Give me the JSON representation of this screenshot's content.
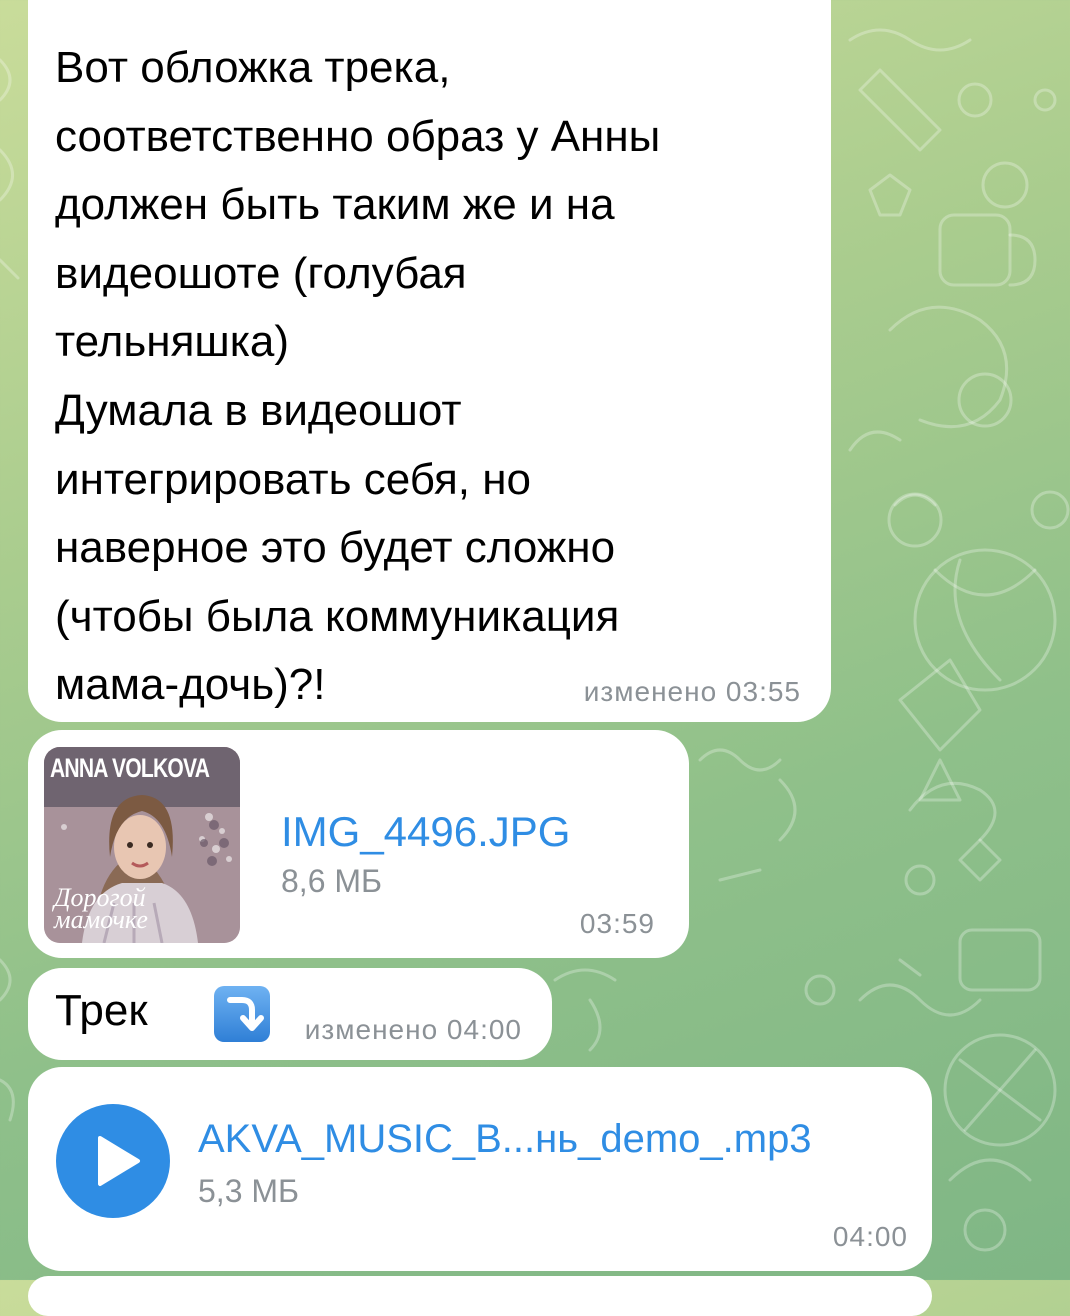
{
  "chat": {
    "messages": [
      {
        "type": "text",
        "text": "Вот обложка трека,\nсоответственно образ у Анны\nдолжен быть таким же и на\nвидеошоте (голубая\nтельняшка)\nДумала в видеошот\nинтегрировать себя, но\nнаверное это будет сложно\n(чтобы была коммуникация\nмама-дочь)?!",
        "meta": "изменено 03:55"
      },
      {
        "type": "photo-file",
        "thumbnail": {
          "title_text": "ANNA VOLKOVA",
          "script_text": "Дорогой\nмамочке"
        },
        "file_name": "IMG_4496.JPG",
        "file_size": "8,6 МБ",
        "time": "03:59"
      },
      {
        "type": "text",
        "text": "Трек",
        "emoji": "arrow-down-right-icon",
        "meta": "изменено 04:00"
      },
      {
        "type": "audio-file",
        "file_name": "AKVA_MUSIC_B...нь_demo_.mp3",
        "file_size": "5,3 МБ",
        "time": "04:00"
      }
    ]
  },
  "colors": {
    "bubble": "#ffffff",
    "link_blue": "#2f8de4",
    "meta_gray": "#8b9196",
    "wallpaper_green": "#9cc68c"
  }
}
